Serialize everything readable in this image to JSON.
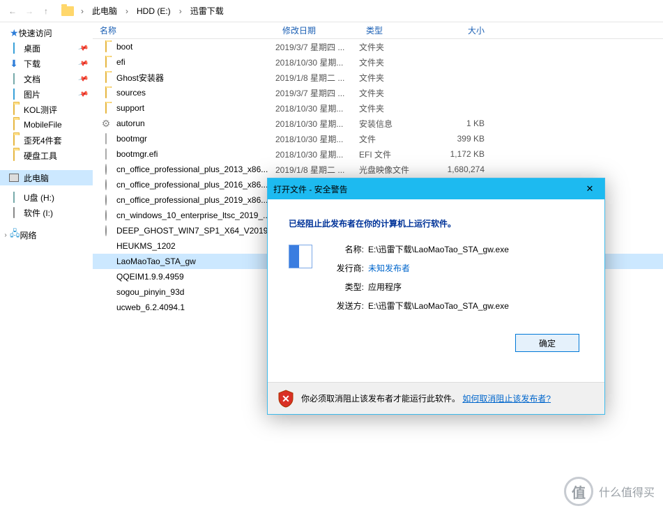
{
  "breadcrumb": {
    "seg1": "此电脑",
    "seg2": "HDD (E:)",
    "seg3": "迅雷下载"
  },
  "columns": {
    "name": "名称",
    "date": "修改日期",
    "type": "类型",
    "size": "大小"
  },
  "sidebar": {
    "quick": "快速访问",
    "items": [
      {
        "label": "桌面",
        "icon": "desktop",
        "pin": true
      },
      {
        "label": "下载",
        "icon": "dl",
        "pin": true
      },
      {
        "label": "文档",
        "icon": "doc",
        "pin": true
      },
      {
        "label": "图片",
        "icon": "pic",
        "pin": true
      },
      {
        "label": "KOL测评",
        "icon": "folder",
        "pin": false
      },
      {
        "label": "MobileFile",
        "icon": "folder",
        "pin": false
      },
      {
        "label": "歪死4件套",
        "icon": "folder",
        "pin": false
      },
      {
        "label": "硬盘工具",
        "icon": "folder",
        "pin": false
      }
    ],
    "thispc": "此电脑",
    "drives": [
      {
        "label": "U盘 (H:)",
        "icon": "usb"
      },
      {
        "label": "软件 (I:)",
        "icon": "drive"
      }
    ],
    "network": "网络"
  },
  "files": [
    {
      "name": "boot",
      "date": "2019/3/7 星期四 ...",
      "type": "文件夹",
      "size": "",
      "icon": "folder"
    },
    {
      "name": "efi",
      "date": "2018/10/30 星期...",
      "type": "文件夹",
      "size": "",
      "icon": "folder"
    },
    {
      "name": "Ghost安装器",
      "date": "2019/1/8 星期二 ...",
      "type": "文件夹",
      "size": "",
      "icon": "folder"
    },
    {
      "name": "sources",
      "date": "2019/3/7 星期四 ...",
      "type": "文件夹",
      "size": "",
      "icon": "folder"
    },
    {
      "name": "support",
      "date": "2018/10/30 星期...",
      "type": "文件夹",
      "size": "",
      "icon": "folder"
    },
    {
      "name": "autorun",
      "date": "2018/10/30 星期...",
      "type": "安装信息",
      "size": "1 KB",
      "icon": "gear"
    },
    {
      "name": "bootmgr",
      "date": "2018/10/30 星期...",
      "type": "文件",
      "size": "399 KB",
      "icon": "file"
    },
    {
      "name": "bootmgr.efi",
      "date": "2018/10/30 星期...",
      "type": "EFI 文件",
      "size": "1,172 KB",
      "icon": "file"
    },
    {
      "name": "cn_office_professional_plus_2013_x86...",
      "date": "2019/1/8 星期二 ...",
      "type": "光盘映像文件",
      "size": "1,680,274",
      "icon": "disc"
    },
    {
      "name": "cn_office_professional_plus_2016_x86...",
      "date": "",
      "type": "",
      "size": "",
      "icon": "disc"
    },
    {
      "name": "cn_office_professional_plus_2019_x86...",
      "date": "",
      "type": "",
      "size": "",
      "icon": "disc"
    },
    {
      "name": "cn_windows_10_enterprise_ltsc_2019_...",
      "date": "",
      "type": "",
      "size": "",
      "icon": "disc"
    },
    {
      "name": "DEEP_GHOST_WIN7_SP1_X64_V2019_...",
      "date": "",
      "type": "",
      "size": "",
      "icon": "disc"
    },
    {
      "name": "HEUKMS_1202",
      "date": "",
      "type": "",
      "size": "",
      "icon": "zip"
    },
    {
      "name": "LaoMaoTao_STA_gw",
      "date": "",
      "type": "",
      "size": "",
      "icon": "globe",
      "selected": true
    },
    {
      "name": "QQEIM1.9.9.4959",
      "date": "",
      "type": "",
      "size": "",
      "icon": "red"
    },
    {
      "name": "sogou_pinyin_93d",
      "date": "",
      "type": "",
      "size": "",
      "icon": "orange"
    },
    {
      "name": "ucweb_6.2.4094.1",
      "date": "",
      "type": "",
      "size": "",
      "icon": "orange"
    }
  ],
  "dialog": {
    "title": "打开文件 - 安全警告",
    "heading": "已经阻止此发布者在你的计算机上运行软件。",
    "name_label": "名称:",
    "name_val": "E:\\迅雷下载\\LaoMaoTao_STA_gw.exe",
    "publisher_label": "发行商:",
    "publisher_val": "未知发布者",
    "type_label": "类型:",
    "type_val": "应用程序",
    "from_label": "发送方:",
    "from_val": "E:\\迅雷下载\\LaoMaoTao_STA_gw.exe",
    "ok": "确定",
    "footer_text": "你必须取消阻止该发布者才能运行此软件。",
    "footer_link": "如何取消阻止该发布者?"
  },
  "watermark": "什么值得买"
}
